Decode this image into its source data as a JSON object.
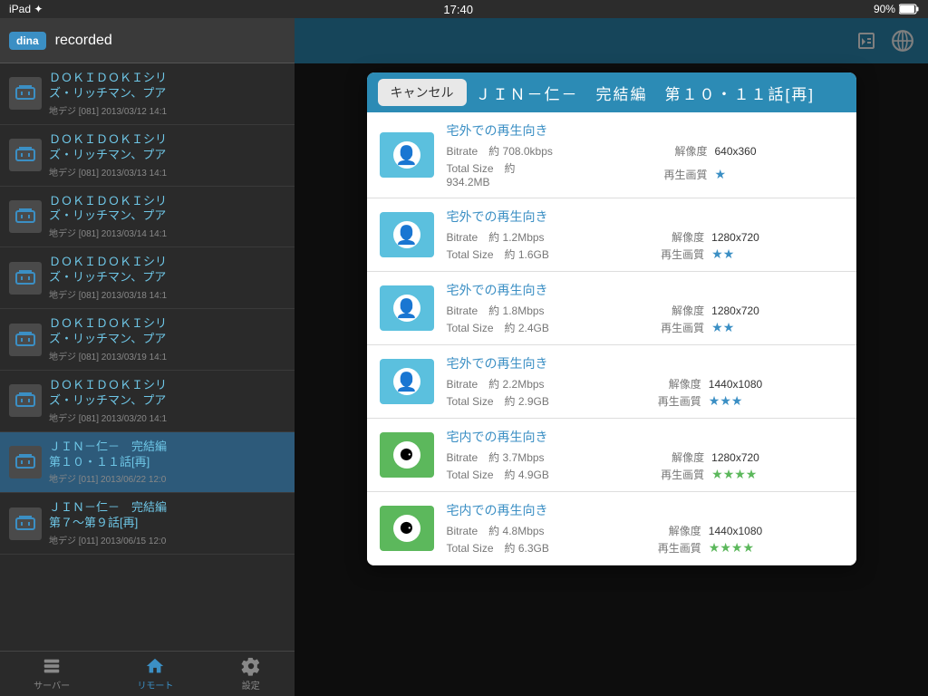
{
  "statusBar": {
    "left": "iPad ✦",
    "time": "17:40",
    "battery": "90%"
  },
  "sidebar": {
    "dina": "dina",
    "title": "recorded",
    "items": [
      {
        "title": "ＤＯＫＩＤＯＫＩシリ\nズ・リッチマン、プア",
        "sub": "地デジ [081] 2013/03/12 14:1"
      },
      {
        "title": "ＤＯＫＩＤＯＫＩシリ\nズ・リッチマン、プア",
        "sub": "地デジ [081] 2013/03/13 14:1"
      },
      {
        "title": "ＤＯＫＩＤＯＫＩシリ\nズ・リッチマン、プア",
        "sub": "地デジ [081] 2013/03/14 14:1"
      },
      {
        "title": "ＤＯＫＩＤＯＫＩシリ\nズ・リッチマン、プア",
        "sub": "地デジ [081] 2013/03/18 14:1"
      },
      {
        "title": "ＤＯＫＩＤＯＫＩシリ\nズ・リッチマン、プア",
        "sub": "地デジ [081] 2013/03/19 14:1"
      },
      {
        "title": "ＤＯＫＩＤＯＫＩシリ\nズ・リッチマン、プア",
        "sub": "地デジ [081] 2013/03/20 14:1"
      },
      {
        "title": "ＪＩＮ－仁－　完結編\n第１０・１１話[再]",
        "sub": "地デジ [011] 2013/06/22 12:0"
      },
      {
        "title": "ＪＩＮ－仁－　完結編\n第７〜第９話[再]",
        "sub": "地デジ [011] 2013/06/15 12:0"
      }
    ]
  },
  "bottomNav": {
    "items": [
      {
        "label": "サーバー",
        "active": false
      },
      {
        "label": "リモート",
        "active": true
      },
      {
        "label": "設定",
        "active": false
      }
    ]
  },
  "modal": {
    "cancelLabel": "キャンセル",
    "title": "ＪＩＮ－仁－　完結編　第１０・１１話[再]",
    "qualities": [
      {
        "type": "outdoor",
        "typeLabel": "宅外での再生向き",
        "bitrate": "約 708.0kbps",
        "totalSize": "約 934.2MB",
        "resolution": "640x360",
        "stars": 1,
        "starColor": "blue"
      },
      {
        "type": "outdoor",
        "typeLabel": "宅外での再生向き",
        "bitrate": "約 1.2Mbps",
        "totalSize": "約 1.6GB",
        "resolution": "1280x720",
        "stars": 2,
        "starColor": "blue"
      },
      {
        "type": "outdoor",
        "typeLabel": "宅外での再生向き",
        "bitrate": "約 1.8Mbps",
        "totalSize": "約 2.4GB",
        "resolution": "1280x720",
        "stars": 2,
        "starColor": "blue"
      },
      {
        "type": "outdoor",
        "typeLabel": "宅外での再生向き",
        "bitrate": "約 2.2Mbps",
        "totalSize": "約 2.9GB",
        "resolution": "1440x1080",
        "stars": 3,
        "starColor": "blue"
      },
      {
        "type": "indoor",
        "typeLabel": "宅内での再生向き",
        "bitrate": "約 3.7Mbps",
        "totalSize": "約 4.9GB",
        "resolution": "1280x720",
        "stars": 4,
        "starColor": "green"
      },
      {
        "type": "indoor",
        "typeLabel": "宅内での再生向き",
        "bitrate": "約 4.8Mbps",
        "totalSize": "約 6.3GB",
        "resolution": "1440x1080",
        "stars": 4,
        "starColor": "green"
      }
    ],
    "labels": {
      "bitrate": "Bitrate",
      "totalSize": "Total Size",
      "resolution": "解像度",
      "quality": "再生画質"
    }
  }
}
